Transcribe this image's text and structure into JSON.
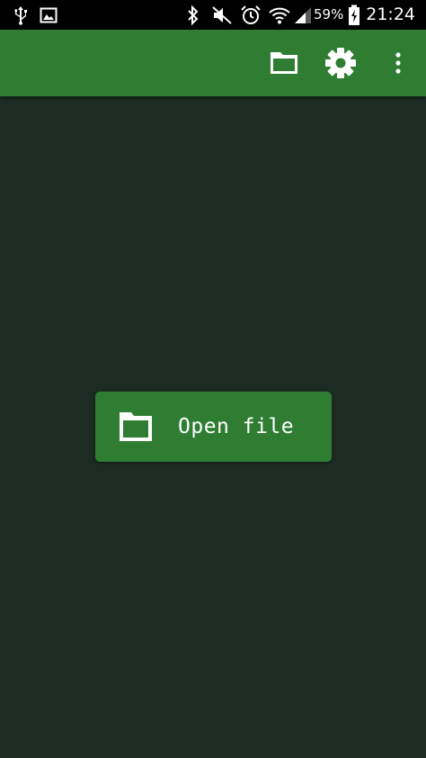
{
  "status_bar": {
    "icons": [
      "usb-icon",
      "image-icon",
      "bluetooth-icon",
      "mute-icon",
      "alarm-icon",
      "wifi-icon",
      "signal-icon",
      "battery-charging-icon"
    ],
    "battery_percent": "59%",
    "time": "21:24"
  },
  "app_bar": {
    "actions": [
      "folder-icon",
      "gear-icon",
      "overflow-menu-icon"
    ],
    "color": "#2e7d32"
  },
  "main": {
    "open_button_label": "Open file",
    "open_button_icon": "folder-icon",
    "background": "#1c2b23"
  }
}
